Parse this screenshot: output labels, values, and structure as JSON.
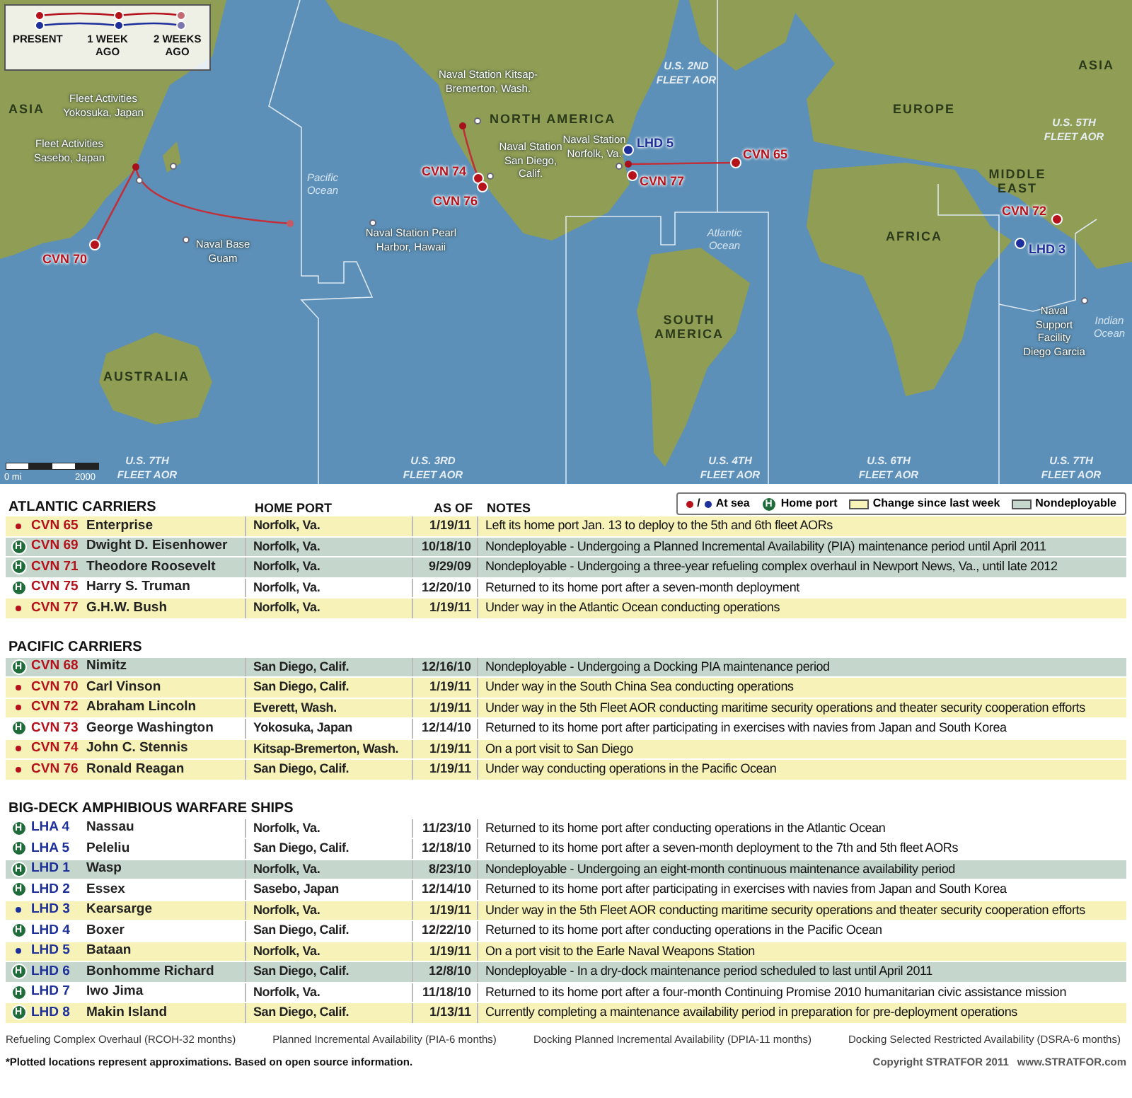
{
  "map": {
    "legend": {
      "labels": [
        "PRESENT",
        "1 WEEK AGO",
        "2 WEEKS AGO"
      ]
    },
    "region_labels": [
      "ASIA",
      "NORTH AMERICA",
      "EUROPE",
      "ASIA",
      "MIDDLE EAST",
      "AFRICA",
      "SOUTH AMERICA",
      "AUSTRALIA"
    ],
    "ocean_labels": [
      "Pacific Ocean",
      "Atlantic Ocean",
      "Indian Ocean"
    ],
    "fleet_labels": [
      "U.S. 2ND FLEET AOR",
      "U.S. 5TH FLEET AOR",
      "U.S. 7TH FLEET AOR",
      "U.S. 3RD FLEET AOR",
      "U.S. 4TH FLEET AOR",
      "U.S. 6TH FLEET AOR",
      "U.S. 7TH FLEET AOR"
    ],
    "bases": [
      "Fleet Activities Yokosuka, Japan",
      "Fleet Activities Sasebo, Japan",
      "Naval Base Guam",
      "Naval Station Pearl Harbor, Hawaii",
      "Naval Station Kitsap-Bremerton, Wash.",
      "Naval Station San Diego, Calif.",
      "Naval Station Norfolk, Va.",
      "Naval Support Facility Diego Garcia"
    ],
    "ships": [
      {
        "label": "CVN 70",
        "color": "#b5121b"
      },
      {
        "label": "CVN 74",
        "color": "#b5121b"
      },
      {
        "label": "CVN 76",
        "color": "#b5121b"
      },
      {
        "label": "LHD 5",
        "color": "#1c2f9a"
      },
      {
        "label": "CVN 65",
        "color": "#b5121b"
      },
      {
        "label": "CVN 77",
        "color": "#b5121b"
      },
      {
        "label": "CVN 72",
        "color": "#b5121b"
      },
      {
        "label": "LHD 3",
        "color": "#1c2f9a"
      }
    ],
    "scale": {
      "start": "0 mi",
      "end": "2000"
    }
  },
  "legend": [
    {
      "kind": "at_sea",
      "label": "At sea",
      "separator": "/"
    },
    {
      "kind": "home_port",
      "label": "Home port",
      "icon_text": "H"
    },
    {
      "kind": "swatch",
      "label": "Change since last week",
      "color": "#f7f2b8"
    },
    {
      "kind": "swatch",
      "label": "Nondeployable",
      "color": "#c5d6cc"
    }
  ],
  "columns": [
    "HOME PORT",
    "AS OF",
    "NOTES"
  ],
  "sections": [
    {
      "title": "ATLANTIC CARRIERS",
      "color": "#b5121b",
      "rows": [
        {
          "hull": "CVN 65",
          "name": "Enterprise",
          "home_port": "Norfolk, Va.",
          "as_of": "1/19/11",
          "notes": "Left its home port Jan. 13 to deploy to the 5th and 6th fleet AORs",
          "at_sea": true,
          "changed": true,
          "nondeployable": false
        },
        {
          "hull": "CVN 69",
          "name": "Dwight D. Eisenhower",
          "home_port": "Norfolk, Va.",
          "as_of": "10/18/10",
          "notes": "Nondeployable - Undergoing a Planned Incremental Availability (PIA) maintenance period until April 2011",
          "at_sea": false,
          "port_icon": "H",
          "nondeployable": true
        },
        {
          "hull": "CVN 71",
          "name": "Theodore Roosevelt",
          "home_port": "Norfolk, Va.",
          "as_of": "9/29/09",
          "notes": "Nondeployable - Undergoing a three-year refueling complex overhaul in Newport News, Va., until late 2012",
          "at_sea": false,
          "port_icon": "H",
          "nondeployable": true
        },
        {
          "hull": "CVN 75",
          "name": "Harry S. Truman",
          "home_port": "Norfolk, Va.",
          "as_of": "12/20/10",
          "notes": "Returned to its home port after a seven-month deployment",
          "at_sea": false,
          "port_icon": "H",
          "changed": false,
          "nondeployable": false
        },
        {
          "hull": "CVN 77",
          "name": "G.H.W. Bush",
          "home_port": "Norfolk, Va.",
          "as_of": "1/19/11",
          "notes": "Under way in the Atlantic Ocean conducting operations",
          "at_sea": true,
          "changed": true,
          "nondeployable": false
        }
      ]
    },
    {
      "title": "PACIFIC CARRIERS",
      "color": "#b5121b",
      "rows": [
        {
          "hull": "CVN 68",
          "name": "Nimitz",
          "home_port": "San Diego, Calif.",
          "as_of": "12/16/10",
          "notes": "Nondeployable - Undergoing a Docking PIA maintenance period",
          "at_sea": false,
          "port_icon": "H",
          "nondeployable": true
        },
        {
          "hull": "CVN 70",
          "name": "Carl Vinson",
          "home_port": "San Diego, Calif.",
          "as_of": "1/19/11",
          "notes": "Under way in the South China Sea conducting operations",
          "at_sea": true,
          "changed": true,
          "nondeployable": false
        },
        {
          "hull": "CVN 72",
          "name": "Abraham Lincoln",
          "home_port": "Everett, Wash.",
          "as_of": "1/19/11",
          "notes": "Under way in the 5th Fleet AOR conducting maritime security operations and theater security cooperation efforts",
          "at_sea": true,
          "changed": true,
          "nondeployable": false
        },
        {
          "hull": "CVN 73",
          "name": "George Washington",
          "home_port": "Yokosuka, Japan",
          "as_of": "12/14/10",
          "notes": "Returned to its home port after participating in exercises with navies from Japan and South Korea",
          "at_sea": false,
          "port_icon": "H",
          "changed": false,
          "nondeployable": false
        },
        {
          "hull": "CVN 74",
          "name": "John C. Stennis",
          "home_port": "Kitsap-Bremerton, Wash.",
          "as_of": "1/19/11",
          "notes": "On a port visit to San Diego",
          "at_sea": true,
          "changed": true,
          "nondeployable": false
        },
        {
          "hull": "CVN 76",
          "name": "Ronald Reagan",
          "home_port": "San Diego, Calif.",
          "as_of": "1/19/11",
          "notes": "Under way conducting operations in the Pacific Ocean",
          "at_sea": true,
          "changed": true,
          "nondeployable": false
        }
      ]
    },
    {
      "title": "BIG-DECK AMPHIBIOUS WARFARE SHIPS",
      "color": "#1c2f9a",
      "rows": [
        {
          "hull": "LHA 4",
          "name": "Nassau",
          "home_port": "Norfolk, Va.",
          "as_of": "11/23/10",
          "notes": "Returned to its home port after conducting operations in the Atlantic Ocean",
          "at_sea": false,
          "port_icon": "H",
          "changed": false,
          "nondeployable": false
        },
        {
          "hull": "LHA 5",
          "name": "Peleliu",
          "home_port": "San Diego, Calif.",
          "as_of": "12/18/10",
          "notes": "Returned to its home port after a seven-month deployment to the 7th and 5th fleet AORs",
          "at_sea": false,
          "port_icon": "H",
          "changed": false,
          "nondeployable": false
        },
        {
          "hull": "LHD 1",
          "name": "Wasp",
          "home_port": "Norfolk, Va.",
          "as_of": "8/23/10",
          "notes": "Nondeployable - Undergoing an eight-month continuous maintenance availability period",
          "at_sea": false,
          "port_icon": "H",
          "nondeployable": true
        },
        {
          "hull": "LHD 2",
          "name": "Essex",
          "home_port": "Sasebo, Japan",
          "as_of": "12/14/10",
          "notes": "Returned to its home port after participating in exercises with navies from Japan and South Korea",
          "at_sea": false,
          "port_icon": "H",
          "changed": false,
          "nondeployable": false
        },
        {
          "hull": "LHD 3",
          "name": "Kearsarge",
          "home_port": "Norfolk, Va.",
          "as_of": "1/19/11",
          "notes": "Under way in the 5th Fleet AOR conducting maritime security operations and theater security cooperation efforts",
          "at_sea": true,
          "changed": true,
          "nondeployable": false
        },
        {
          "hull": "LHD 4",
          "name": "Boxer",
          "home_port": "San Diego, Calif.",
          "as_of": "12/22/10",
          "notes": "Returned to its home port after conducting operations in the Pacific Ocean",
          "at_sea": false,
          "port_icon": "H",
          "changed": false,
          "nondeployable": false
        },
        {
          "hull": "LHD 5",
          "name": "Bataan",
          "home_port": "Norfolk, Va.",
          "as_of": "1/19/11",
          "notes": "On a port visit to the Earle Naval Weapons Station",
          "at_sea": true,
          "changed": true,
          "nondeployable": false
        },
        {
          "hull": "LHD 6",
          "name": "Bonhomme Richard",
          "home_port": "San Diego, Calif.",
          "as_of": "12/8/10",
          "notes": "Nondeployable - In a dry-dock maintenance period scheduled to last until April 2011",
          "at_sea": false,
          "port_icon": "H",
          "nondeployable": true
        },
        {
          "hull": "LHD 7",
          "name": "Iwo Jima",
          "home_port": "Norfolk, Va.",
          "as_of": "11/18/10",
          "notes": "Returned to its home port after a four-month Continuing Promise 2010 humanitarian civic assistance mission",
          "at_sea": false,
          "port_icon": "H",
          "changed": false,
          "nondeployable": false
        },
        {
          "hull": "LHD 8",
          "name": "Makin Island",
          "home_port": "San Diego, Calif.",
          "as_of": "1/13/11",
          "notes": "Currently completing a maintenance availability period in preparation for pre-deployment operations",
          "at_sea": false,
          "port_icon": "H",
          "changed": true,
          "nondeployable": false
        }
      ]
    }
  ],
  "glossary": [
    "Refueling Complex Overhaul (RCOH-32 months)",
    "Planned Incremental Availability (PIA-6 months)",
    "Docking Planned Incremental Availability (DPIA-11 months)",
    "Docking Selected Restricted Availability (DSRA-6 months)"
  ],
  "footnote": "*Plotted locations represent approximations. Based on open source information.",
  "copyright": "Copyright STRATFOR 2011",
  "website": "www.STRATFOR.com"
}
